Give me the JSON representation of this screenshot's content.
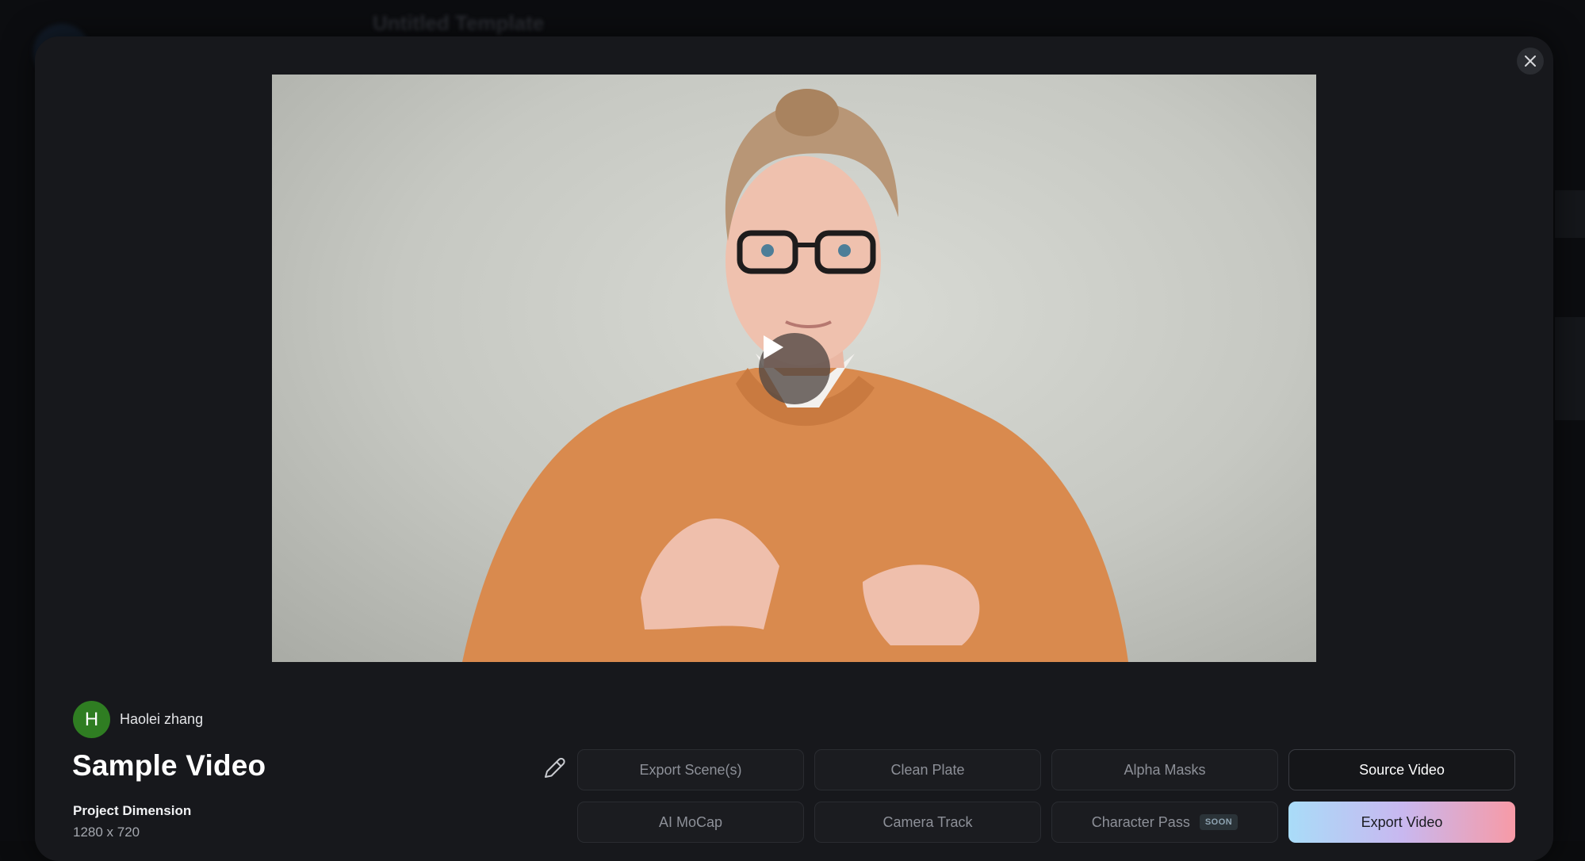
{
  "background": {
    "project_title": "Untitled Template"
  },
  "modal": {
    "close_icon": "close-icon",
    "video": {
      "play_icon": "play-icon"
    },
    "author": {
      "initial": "H",
      "name": "Haolei zhang",
      "avatar_color": "#2f7d22"
    },
    "title": "Sample Video",
    "edit_icon": "pencil-icon",
    "project_dimension": {
      "label": "Project Dimension",
      "value": "1280 x 720"
    },
    "actions": {
      "export_scenes": "Export Scene(s)",
      "clean_plate": "Clean Plate",
      "alpha_masks": "Alpha Masks",
      "source_video": "Source Video",
      "ai_mocap": "AI MoCap",
      "camera_track": "Camera Track",
      "character_pass": "Character Pass",
      "soon_badge": "SOON",
      "export_video": "Export Video"
    }
  }
}
